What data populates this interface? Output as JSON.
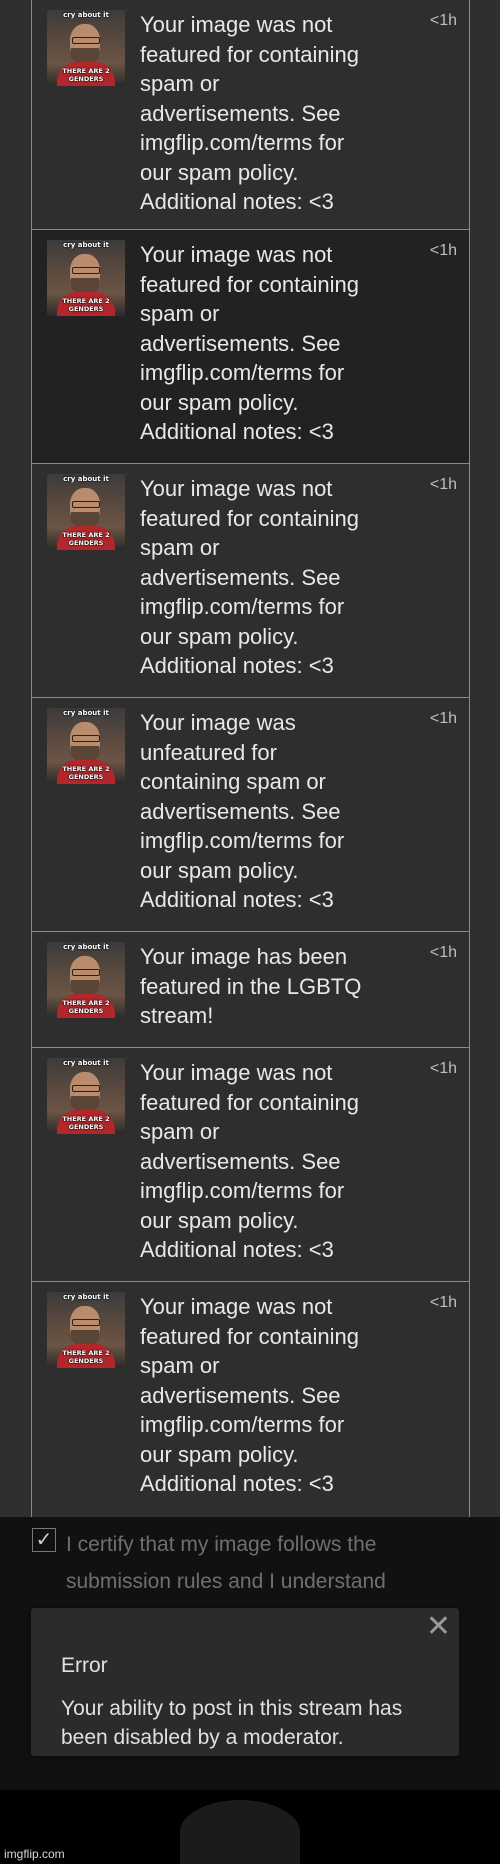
{
  "thumbnail": {
    "top_text": "cry about it",
    "bottom_text": "THERE ARE 2 GENDERS"
  },
  "notifications": [
    {
      "message": "Your image was not featured for containing spam or advertisements. See imgflip.com/terms for our spam policy. Additional notes: <3",
      "time": "<1h"
    },
    {
      "message": "Your image was not featured for containing spam or advertisements. See imgflip.com/terms for our spam policy. Additional notes: <3",
      "time": "<1h"
    },
    {
      "message": "Your image was not featured for containing spam or advertisements. See imgflip.com/terms for our spam policy. Additional notes: <3",
      "time": "<1h"
    },
    {
      "message": "Your image was unfeatured for containing spam or advertisements. See imgflip.com/terms for our spam policy. Additional notes: <3",
      "time": "<1h"
    },
    {
      "message": "Your image has been featured in the LGBTQ stream!",
      "time": "<1h"
    },
    {
      "message": "Your image was not featured for containing spam or advertisements. See imgflip.com/terms for our spam policy. Additional notes: <3",
      "time": "<1h"
    },
    {
      "message": "Your image was not featured for containing spam or advertisements. See imgflip.com/terms for our spam policy. Additional notes: <3",
      "time": "<1h"
    }
  ],
  "certify": {
    "checked": true,
    "text": "I certify that my image follows the submission rules and I understand"
  },
  "error_dialog": {
    "close_glyph": "✕",
    "title": "Error",
    "body": "Your ability to post in this stream has been disabled by a moderator."
  },
  "watermark": "imgflip.com"
}
